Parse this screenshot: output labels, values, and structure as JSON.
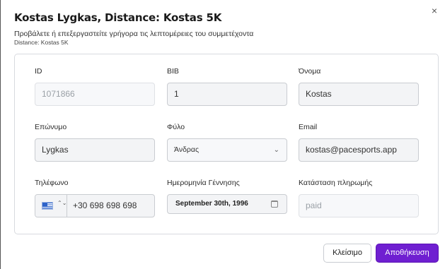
{
  "dialog": {
    "title": "Kostas Lygkas, Distance: Kostas 5K",
    "subtitle": "Προβάλετε ή επεξεργαστείτε γρήγορα τις λεπτομέρειες του συμμετέχοντα",
    "distance_line": "Distance: Kostas 5K",
    "close_glyph": "×"
  },
  "fields": {
    "id": {
      "label": "ID",
      "value": "1071866"
    },
    "bib": {
      "label": "BIB",
      "value": "1"
    },
    "first_name": {
      "label": "Όνομα",
      "value": "Kostas"
    },
    "last_name": {
      "label": "Επώνυμο",
      "value": "Lygkas"
    },
    "gender": {
      "label": "Φύλο",
      "value": "Άνδρας",
      "chevron": "⌄"
    },
    "email": {
      "label": "Email",
      "value": "kostas@pacesports.app"
    },
    "phone": {
      "label": "Τηλέφωνο",
      "country_flag": "greece-flag-icon",
      "updown": "⌃⌄",
      "value": "+30 698 698 698"
    },
    "birth_date": {
      "label": "Ημερομηνία Γέννησης",
      "value": "September 30th, 1996",
      "icon": "calendar-icon"
    },
    "payment_status": {
      "label": "Κατάσταση πληρωμής",
      "value": "paid"
    }
  },
  "buttons": {
    "close_label": "Κλείσιμο",
    "save_label": "Αποθήκευση"
  },
  "colors": {
    "primary": "#6f1fd1",
    "input_bg": "#f3f4f6",
    "border": "#c9ccd1"
  }
}
